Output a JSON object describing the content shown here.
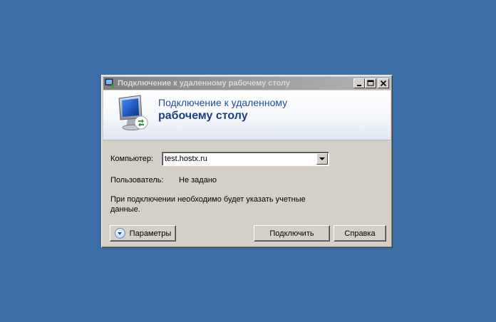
{
  "window": {
    "title": "Подключение к удаленному рабочему столу",
    "icon": "remote-desktop-icon",
    "controls": [
      "minimize-icon",
      "maximize-icon",
      "close-icon"
    ]
  },
  "banner": {
    "line1": "Подключение к удаленному",
    "line2": "рабочему столу",
    "icon": "monitor-connection-icon"
  },
  "form": {
    "computer_label": "Компьютер:",
    "computer_value": "test.hostx.ru",
    "user_label": "Пользователь:",
    "user_value": "Не задано",
    "info_line1": "При подключении необходимо будет указать учетные",
    "info_line2": "данные."
  },
  "buttons": {
    "options": "Параметры",
    "connect": "Подключить",
    "help": "Справка"
  },
  "colors": {
    "desktop": "#3a6ea5",
    "window": "#d4d0c8",
    "banner_text": "#1f4e9c"
  }
}
